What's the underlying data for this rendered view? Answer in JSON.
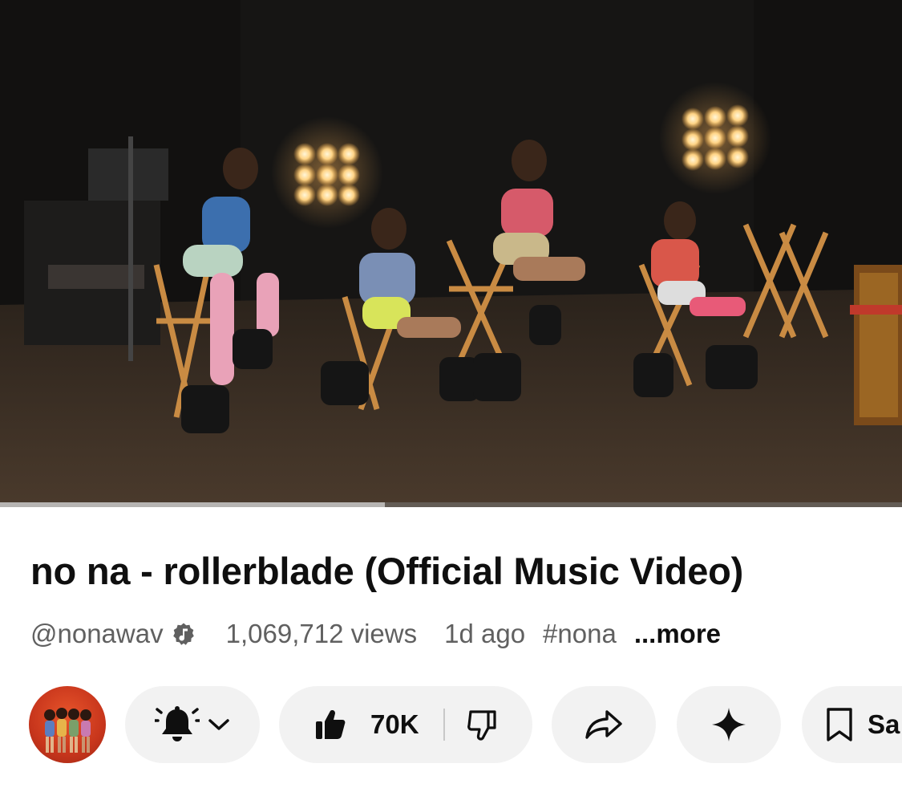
{
  "video": {
    "progress_buffered": 0.427
  },
  "info": {
    "title": "no na - rollerblade (Official Music Video)",
    "channel_handle": "@nonawav",
    "views": "1,069,712 views",
    "age": "1d ago",
    "hashtag": "#nona",
    "more_label": "...more"
  },
  "actions": {
    "avatar_icon": "channel-avatar",
    "subscribe_icon": "bell-ringing-icon",
    "like_count": "70K",
    "share_icon": "share-arrow-icon",
    "ask_icon": "sparkle-icon",
    "save_label": "Sa"
  },
  "colors": {
    "text_primary": "#0f0f0f",
    "text_secondary": "#606060",
    "pill_background": "#f2f2f2"
  }
}
